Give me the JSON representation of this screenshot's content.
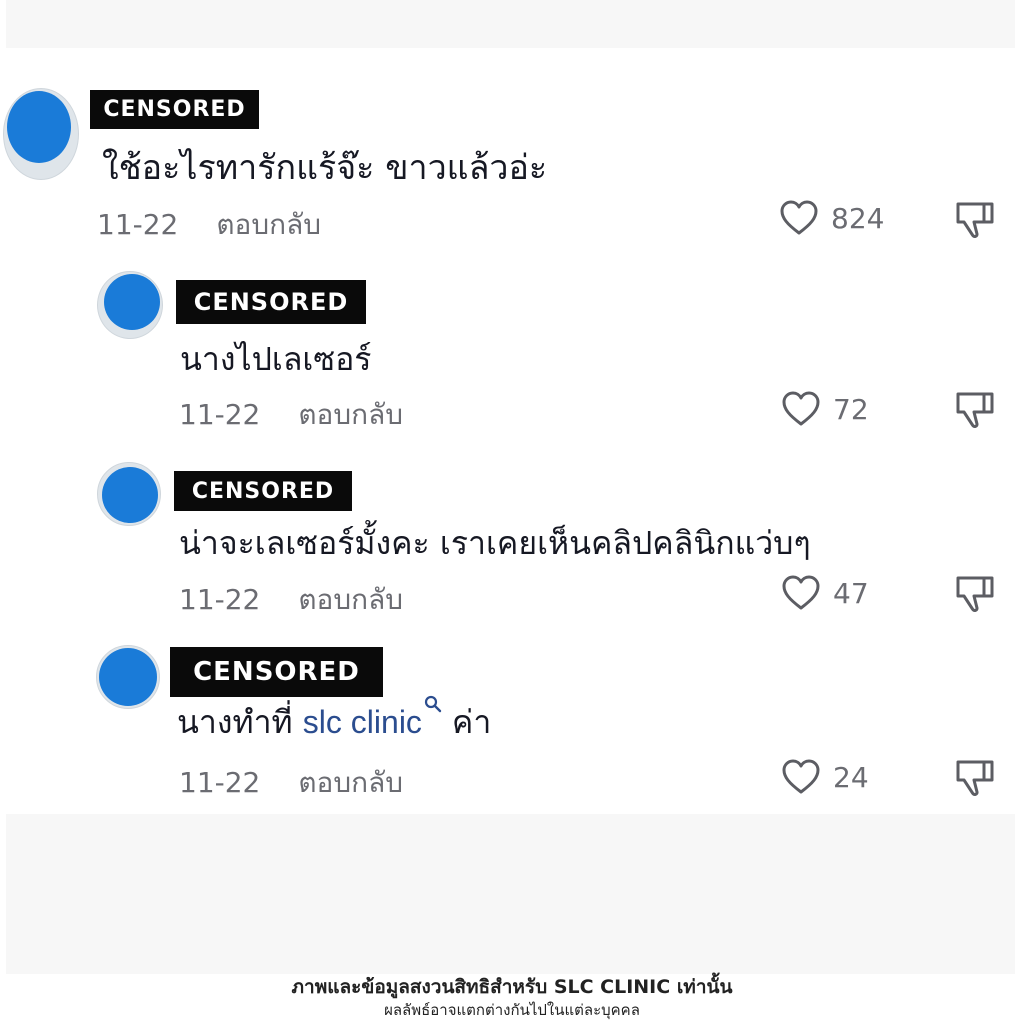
{
  "comments": [
    {
      "username": "CENSORED",
      "text": "ใช้อะไรทารักแร้จ๊ะ ขาวแล้วอ่ะ",
      "date": "11-22",
      "reply_label": "ตอบกลับ",
      "likes": "824"
    },
    {
      "username": "CENSORED",
      "text": "นางไปเลเซอร์",
      "date": "11-22",
      "reply_label": "ตอบกลับ",
      "likes": "72"
    },
    {
      "username": "CENSORED",
      "text": "น่าจะเลเซอร์มั้งคะ เราเคยเห็นคลิปคลินิกแว่บๆ",
      "date": "11-22",
      "reply_label": "ตอบกลับ",
      "likes": "47"
    },
    {
      "username": "CENSORED",
      "text_before": "นางทำที่",
      "mention": "slc clinic",
      "text_after": "ค่า",
      "date": "11-22",
      "reply_label": "ตอบกลับ",
      "likes": "24"
    }
  ],
  "footer": {
    "line1": "ภาพและข้อมูลสงวนสิทธิสำหรับ  SLC CLINIC เท่านั้น",
    "line2": "ผลลัพธ์อาจแตกต่างกันไปในแต่ละบุคคล"
  },
  "colors": {
    "text": "#161823",
    "meta": "#6b6c72",
    "mention": "#2b4d8f",
    "censor_bg": "#0a0a0a",
    "avatar_blur": "#1a7bd8"
  },
  "icons": {
    "like": "heart-outline-icon",
    "dislike": "thumbs-down-icon",
    "mention": "search-icon"
  }
}
